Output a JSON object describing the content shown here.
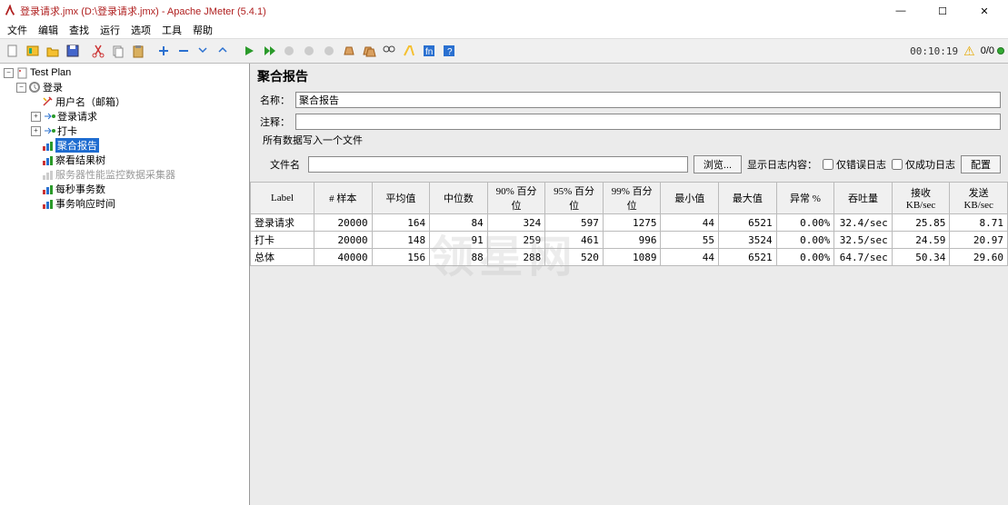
{
  "window": {
    "title": "登录请求.jmx (D:\\登录请求.jmx) - Apache JMeter (5.4.1)",
    "min": "—",
    "max": "☐",
    "close": "✕"
  },
  "menu": {
    "file": "文件",
    "edit": "编辑",
    "search": "查找",
    "run": "运行",
    "options": "选项",
    "tools": "工具",
    "help": "帮助"
  },
  "toolbar_status": {
    "timer": "00:10:19",
    "counter": "0/0"
  },
  "tree": {
    "root": "Test Plan",
    "tg": "登录",
    "n_user": "用户名（邮箱）",
    "n_login": "登录请求",
    "n_daka": "打卡",
    "n_agg": "聚合报告",
    "n_results": "察看结果树",
    "n_server": "服务器性能监控数据采集器",
    "n_tps": "每秒事务数",
    "n_resp": "事务响应时间"
  },
  "panel": {
    "title": "聚合报告",
    "name_label": "名称：",
    "name_value": "聚合报告",
    "comment_label": "注释：",
    "comment_value": "",
    "file_header": "所有数据写入一个文件",
    "file_label": "文件名",
    "file_value": "",
    "browse": "浏览...",
    "show_log": "显示日志内容：",
    "only_err": "仅错误日志",
    "only_ok": "仅成功日志",
    "config": "配置"
  },
  "table": {
    "headers": [
      "Label",
      "# 样本",
      "平均值",
      "中位数",
      "90% 百分位",
      "95% 百分位",
      "99% 百分位",
      "最小值",
      "最大值",
      "异常 %",
      "吞吐量",
      "接收 KB/sec",
      "发送 KB/sec"
    ],
    "rows": [
      {
        "label": "登录请求",
        "samples": "20000",
        "avg": "164",
        "med": "84",
        "p90": "324",
        "p95": "597",
        "p99": "1275",
        "min": "44",
        "max": "6521",
        "err": "0.00%",
        "thr": "32.4/sec",
        "recv": "25.85",
        "sent": "8.71"
      },
      {
        "label": "打卡",
        "samples": "20000",
        "avg": "148",
        "med": "91",
        "p90": "259",
        "p95": "461",
        "p99": "996",
        "min": "55",
        "max": "3524",
        "err": "0.00%",
        "thr": "32.5/sec",
        "recv": "24.59",
        "sent": "20.97"
      },
      {
        "label": "总体",
        "samples": "40000",
        "avg": "156",
        "med": "88",
        "p90": "288",
        "p95": "520",
        "p99": "1089",
        "min": "44",
        "max": "6521",
        "err": "0.00%",
        "thr": "64.7/sec",
        "recv": "50.34",
        "sent": "29.60"
      }
    ]
  },
  "watermark": "领星网",
  "chart_data": {
    "type": "table",
    "title": "聚合报告 (Aggregate Report)",
    "columns": [
      "Label",
      "# 样本",
      "平均值",
      "中位数",
      "90% 百分位",
      "95% 百分位",
      "99% 百分位",
      "最小值",
      "最大值",
      "异常 %",
      "吞吐量",
      "接收 KB/sec",
      "发送 KB/sec"
    ],
    "rows": [
      [
        "登录请求",
        20000,
        164,
        84,
        324,
        597,
        1275,
        44,
        6521,
        "0.00%",
        "32.4/sec",
        25.85,
        8.71
      ],
      [
        "打卡",
        20000,
        148,
        91,
        259,
        461,
        996,
        55,
        3524,
        "0.00%",
        "32.5/sec",
        24.59,
        20.97
      ],
      [
        "总体",
        40000,
        156,
        88,
        288,
        520,
        1089,
        44,
        6521,
        "0.00%",
        "64.7/sec",
        50.34,
        29.6
      ]
    ]
  }
}
